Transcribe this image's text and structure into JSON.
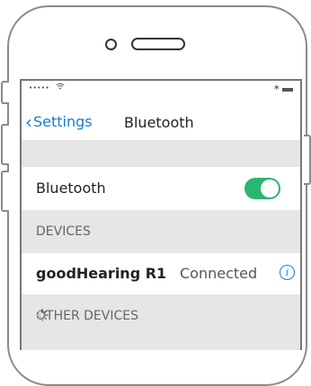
{
  "statusbar": {
    "signal": "•••••",
    "bluetooth_glyph": "∗"
  },
  "nav": {
    "back_label": "Settings",
    "back_chevron": "‹",
    "title": "Bluetooth"
  },
  "bluetooth_row": {
    "label": "Bluetooth",
    "toggle_on": true,
    "toggle_color": "#2cb572"
  },
  "sections": {
    "devices": "DEVICES",
    "other_devices": "OTHER DEVICES"
  },
  "device": {
    "name": "goodHearing R1",
    "status": "Connected",
    "info_glyph": "i"
  },
  "colors": {
    "accent": "#1a7ccf",
    "section_bg": "#e6e6e6"
  }
}
